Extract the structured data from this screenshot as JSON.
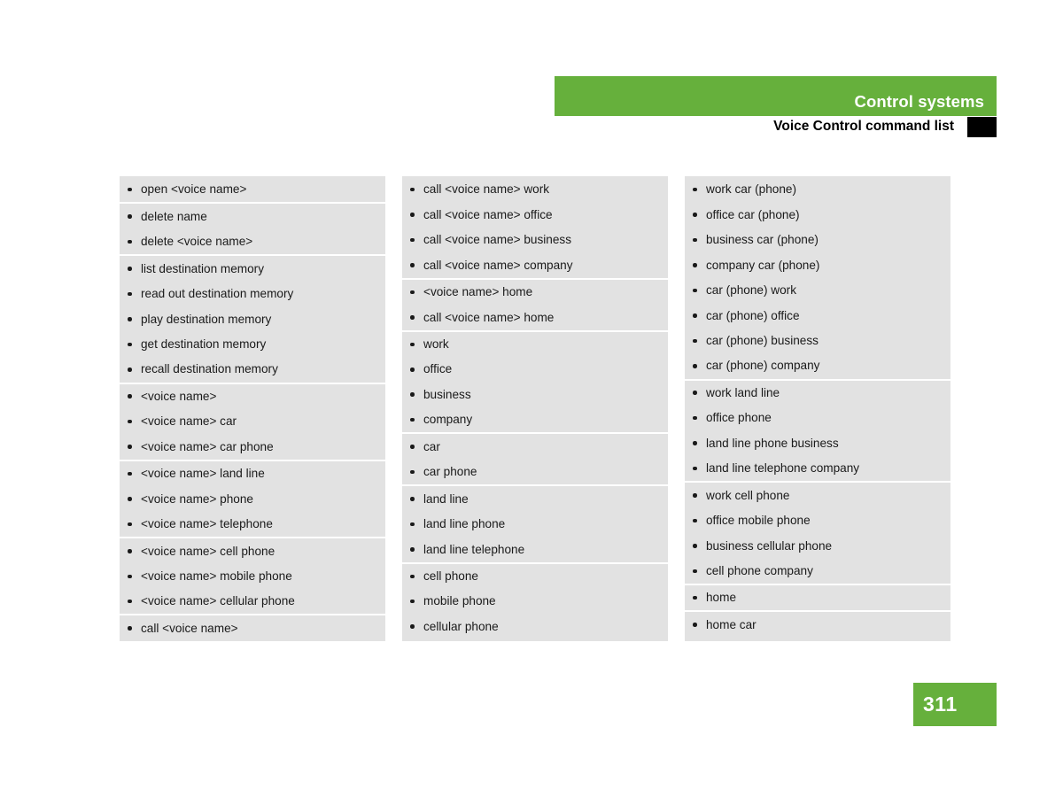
{
  "header": {
    "section_title": "Control systems",
    "subtitle": "Voice Control command list",
    "accent_color": "#66B03C",
    "tab_marker_color": "#000000"
  },
  "page": {
    "number": "311",
    "background_color": "#ffffff",
    "list_background_color": "#E2E2E2",
    "separator_color": "#FFFFFF"
  },
  "columns": [
    {
      "groups": [
        {
          "items": [
            "open <voice name>"
          ]
        },
        {
          "items": [
            "delete name",
            "delete <voice name>"
          ]
        },
        {
          "items": [
            "list destination memory",
            "read out destination memory",
            "play destination memory",
            "get destination memory",
            "recall destination memory"
          ]
        },
        {
          "items": [
            "<voice name>",
            "<voice name> car",
            "<voice name> car phone"
          ]
        },
        {
          "items": [
            "<voice name> land line",
            "<voice name> phone",
            "<voice name> telephone"
          ]
        },
        {
          "items": [
            "<voice name> cell phone",
            "<voice name> mobile phone",
            "<voice name> cellular phone"
          ]
        },
        {
          "items": [
            "call <voice name>"
          ]
        }
      ]
    },
    {
      "groups": [
        {
          "items": [
            "call <voice name> work",
            "call <voice name> office",
            "call <voice name> business",
            "call <voice name> company"
          ]
        },
        {
          "items": [
            "<voice name> home",
            "call <voice name> home"
          ]
        },
        {
          "items": [
            "work",
            "office",
            "business",
            "company"
          ]
        },
        {
          "items": [
            "car",
            "car phone"
          ]
        },
        {
          "items": [
            "land line",
            "land line phone",
            "land line telephone"
          ]
        },
        {
          "items": [
            "cell phone",
            "mobile phone",
            "cellular phone"
          ]
        }
      ]
    },
    {
      "groups": [
        {
          "items": [
            "work car (phone)",
            "office car (phone)",
            "business car (phone)",
            "company car (phone)",
            "car (phone) work",
            "car (phone) office",
            "car (phone) business",
            "car (phone) company"
          ]
        },
        {
          "items": [
            "work land line",
            "office phone",
            "land line phone business",
            "land line telephone company"
          ]
        },
        {
          "items": [
            "work cell phone",
            "office mobile phone",
            "business cellular phone",
            "cell phone company"
          ]
        },
        {
          "items": [
            "home"
          ]
        },
        {
          "items": [
            "home car"
          ]
        }
      ]
    }
  ]
}
